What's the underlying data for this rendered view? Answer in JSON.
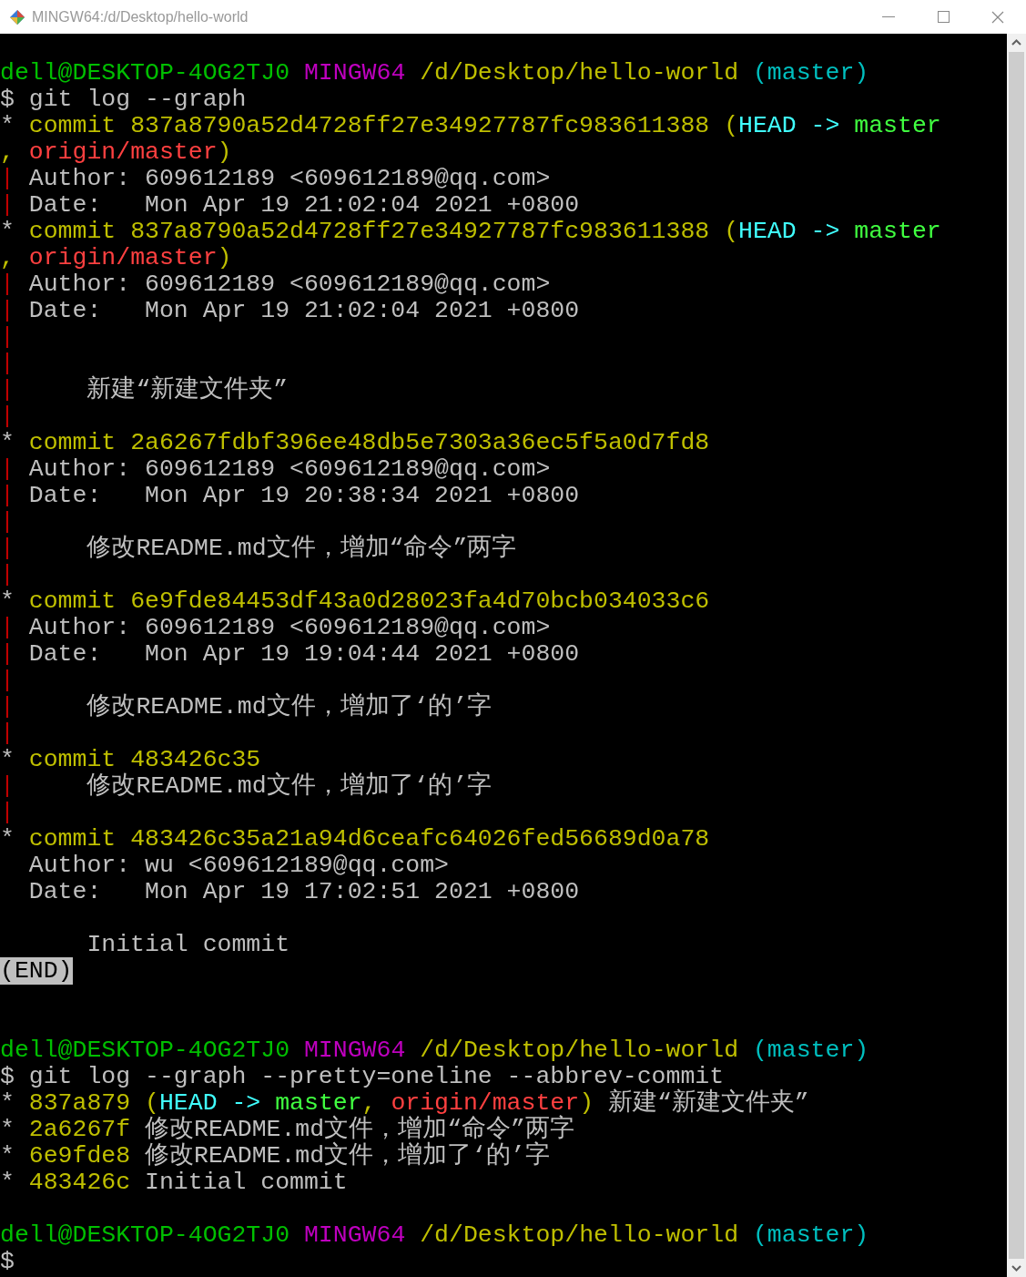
{
  "window": {
    "title": "MINGW64:/d/Desktop/hello-world"
  },
  "lines": [
    {
      "kind": "blank"
    },
    {
      "kind": "text",
      "segments": [
        {
          "text": "dell@DESKTOP-4OG2TJ0",
          "color": "#00bf00"
        },
        {
          "text": " MINGW64",
          "color": "#bf00bf"
        },
        {
          "text": " /d/Desktop/hello-world",
          "color": "#bfbf00"
        },
        {
          "text": " (master)",
          "color": "#00bfbf"
        }
      ]
    },
    {
      "kind": "text",
      "segments": [
        {
          "text": "$ git log --graph",
          "color": "#bfbfbf"
        }
      ]
    },
    {
      "kind": "text",
      "segments": [
        {
          "text": "*",
          "color": "#bfbfbf"
        },
        {
          "text": " commit 837a8790a52d4728ff27e34927787fc983611388 (",
          "color": "#bfbf00"
        },
        {
          "text": "HEAD ->",
          "color": "#40ffff"
        },
        {
          "text": " master",
          "color": "#40ff40"
        }
      ]
    },
    {
      "kind": "text",
      "segments": [
        {
          "text": ",",
          "color": "#bfbf00"
        },
        {
          "text": " origin/master",
          "color": "#ff4040"
        },
        {
          "text": ")",
          "color": "#bfbf00"
        }
      ]
    },
    {
      "kind": "text",
      "segments": [
        {
          "text": "|",
          "color": "#bf0000"
        },
        {
          "text": " Author: 609612189 <609612189@qq.com>",
          "color": "#bfbfbf"
        }
      ]
    },
    {
      "kind": "text",
      "segments": [
        {
          "text": "|",
          "color": "#bf0000"
        },
        {
          "text": " Date:   Mon Apr 19 21:02:04 2021 +0800",
          "color": "#bfbfbf"
        }
      ]
    },
    {
      "kind": "text",
      "segments": [
        {
          "text": "*",
          "color": "#bfbfbf"
        },
        {
          "text": " commit 837a8790a52d4728ff27e34927787fc983611388 (",
          "color": "#bfbf00"
        },
        {
          "text": "HEAD ->",
          "color": "#40ffff"
        },
        {
          "text": " master",
          "color": "#40ff40"
        }
      ]
    },
    {
      "kind": "text",
      "segments": [
        {
          "text": ",",
          "color": "#bfbf00"
        },
        {
          "text": " origin/master",
          "color": "#ff4040"
        },
        {
          "text": ")",
          "color": "#bfbf00"
        }
      ]
    },
    {
      "kind": "text",
      "segments": [
        {
          "text": "|",
          "color": "#bf0000"
        },
        {
          "text": " Author: 609612189 <609612189@qq.com>",
          "color": "#bfbfbf"
        }
      ]
    },
    {
      "kind": "text",
      "segments": [
        {
          "text": "|",
          "color": "#bf0000"
        },
        {
          "text": " Date:   Mon Apr 19 21:02:04 2021 +0800",
          "color": "#bfbfbf"
        }
      ]
    },
    {
      "kind": "text",
      "segments": [
        {
          "text": "|",
          "color": "#bf0000"
        }
      ]
    },
    {
      "kind": "text",
      "segments": [
        {
          "text": "|",
          "color": "#bf0000"
        }
      ]
    },
    {
      "kind": "text",
      "segments": [
        {
          "text": "|",
          "color": "#bf0000"
        },
        {
          "text": "     新建“新建文件夹”",
          "color": "#bfbfbf"
        }
      ]
    },
    {
      "kind": "text",
      "segments": [
        {
          "text": "|",
          "color": "#bf0000"
        }
      ]
    },
    {
      "kind": "text",
      "segments": [
        {
          "text": "*",
          "color": "#bfbfbf"
        },
        {
          "text": " commit 2a6267fdbf396ee48db5e7303a36ec5f5a0d7fd8",
          "color": "#bfbf00"
        }
      ]
    },
    {
      "kind": "text",
      "segments": [
        {
          "text": "|",
          "color": "#bf0000"
        },
        {
          "text": " Author: 609612189 <609612189@qq.com>",
          "color": "#bfbfbf"
        }
      ]
    },
    {
      "kind": "text",
      "segments": [
        {
          "text": "|",
          "color": "#bf0000"
        },
        {
          "text": " Date:   Mon Apr 19 20:38:34 2021 +0800",
          "color": "#bfbfbf"
        }
      ]
    },
    {
      "kind": "text",
      "segments": [
        {
          "text": "|",
          "color": "#bf0000"
        }
      ]
    },
    {
      "kind": "text",
      "segments": [
        {
          "text": "|",
          "color": "#bf0000"
        },
        {
          "text": "     修改README.md文件，增加“命令”两字",
          "color": "#bfbfbf"
        }
      ]
    },
    {
      "kind": "text",
      "segments": [
        {
          "text": "|",
          "color": "#bf0000"
        }
      ]
    },
    {
      "kind": "text",
      "segments": [
        {
          "text": "*",
          "color": "#bfbfbf"
        },
        {
          "text": " commit 6e9fde84453df43a0d28023fa4d70bcb034033c6",
          "color": "#bfbf00"
        }
      ]
    },
    {
      "kind": "text",
      "segments": [
        {
          "text": "|",
          "color": "#bf0000"
        },
        {
          "text": " Author: 609612189 <609612189@qq.com>",
          "color": "#bfbfbf"
        }
      ]
    },
    {
      "kind": "text",
      "segments": [
        {
          "text": "|",
          "color": "#bf0000"
        },
        {
          "text": " Date:   Mon Apr 19 19:04:44 2021 +0800",
          "color": "#bfbfbf"
        }
      ]
    },
    {
      "kind": "text",
      "segments": [
        {
          "text": "|",
          "color": "#bf0000"
        }
      ]
    },
    {
      "kind": "text",
      "segments": [
        {
          "text": "|",
          "color": "#bf0000"
        },
        {
          "text": "     修改README.md文件，增加了‘的’字",
          "color": "#bfbfbf"
        }
      ]
    },
    {
      "kind": "text",
      "segments": [
        {
          "text": "|",
          "color": "#bf0000"
        }
      ]
    },
    {
      "kind": "text",
      "segments": [
        {
          "text": "*",
          "color": "#bfbfbf"
        },
        {
          "text": " commit 483426c35",
          "color": "#bfbf00"
        }
      ]
    },
    {
      "kind": "text",
      "segments": [
        {
          "text": "|",
          "color": "#bf0000"
        },
        {
          "text": "     修改README.md文件，增加了‘的’字",
          "color": "#bfbfbf"
        }
      ]
    },
    {
      "kind": "text",
      "segments": [
        {
          "text": "|",
          "color": "#bf0000"
        }
      ]
    },
    {
      "kind": "text",
      "segments": [
        {
          "text": "*",
          "color": "#bfbfbf"
        },
        {
          "text": " commit 483426c35a21a94d6ceafc64026fed56689d0a78",
          "color": "#bfbf00"
        }
      ]
    },
    {
      "kind": "text",
      "segments": [
        {
          "text": "  Author: wu <609612189@qq.com>",
          "color": "#bfbfbf"
        }
      ]
    },
    {
      "kind": "text",
      "segments": [
        {
          "text": "  Date:   Mon Apr 19 17:02:51 2021 +0800",
          "color": "#bfbfbf"
        }
      ]
    },
    {
      "kind": "blank"
    },
    {
      "kind": "text",
      "segments": [
        {
          "text": "      Initial commit",
          "color": "#bfbfbf"
        }
      ]
    },
    {
      "kind": "pager",
      "text": "(END)"
    },
    {
      "kind": "blank"
    },
    {
      "kind": "blank"
    },
    {
      "kind": "text",
      "segments": [
        {
          "text": "dell@DESKTOP-4OG2TJ0",
          "color": "#00bf00"
        },
        {
          "text": " MINGW64",
          "color": "#bf00bf"
        },
        {
          "text": " /d/Desktop/hello-world",
          "color": "#bfbf00"
        },
        {
          "text": " (master)",
          "color": "#00bfbf"
        }
      ]
    },
    {
      "kind": "text",
      "segments": [
        {
          "text": "$ git log --graph --pretty=oneline --abbrev-commit",
          "color": "#bfbfbf"
        }
      ]
    },
    {
      "kind": "text",
      "segments": [
        {
          "text": "*",
          "color": "#bfbfbf"
        },
        {
          "text": " 837a879 (",
          "color": "#bfbf00"
        },
        {
          "text": "HEAD ->",
          "color": "#40ffff"
        },
        {
          "text": " master",
          "color": "#40ff40"
        },
        {
          "text": ",",
          "color": "#bfbf00"
        },
        {
          "text": " origin/master",
          "color": "#ff4040"
        },
        {
          "text": ")",
          "color": "#bfbf00"
        },
        {
          "text": " 新建“新建文件夹”",
          "color": "#bfbfbf"
        }
      ]
    },
    {
      "kind": "text",
      "segments": [
        {
          "text": "*",
          "color": "#bfbfbf"
        },
        {
          "text": " 2a6267f",
          "color": "#bfbf00"
        },
        {
          "text": " 修改README.md文件，增加“命令”两字",
          "color": "#bfbfbf"
        }
      ]
    },
    {
      "kind": "text",
      "segments": [
        {
          "text": "*",
          "color": "#bfbfbf"
        },
        {
          "text": " 6e9fde8",
          "color": "#bfbf00"
        },
        {
          "text": " 修改README.md文件，增加了‘的’字",
          "color": "#bfbfbf"
        }
      ]
    },
    {
      "kind": "text",
      "segments": [
        {
          "text": "*",
          "color": "#bfbfbf"
        },
        {
          "text": " 483426c",
          "color": "#bfbf00"
        },
        {
          "text": " Initial commit",
          "color": "#bfbfbf"
        }
      ]
    },
    {
      "kind": "blank"
    },
    {
      "kind": "text",
      "segments": [
        {
          "text": "dell@DESKTOP-4OG2TJ0",
          "color": "#00bf00"
        },
        {
          "text": " MINGW64",
          "color": "#bf00bf"
        },
        {
          "text": " /d/Desktop/hello-world",
          "color": "#bfbf00"
        },
        {
          "text": " (master)",
          "color": "#00bfbf"
        }
      ]
    },
    {
      "kind": "text",
      "segments": [
        {
          "text": "$",
          "color": "#bfbfbf"
        }
      ]
    }
  ]
}
